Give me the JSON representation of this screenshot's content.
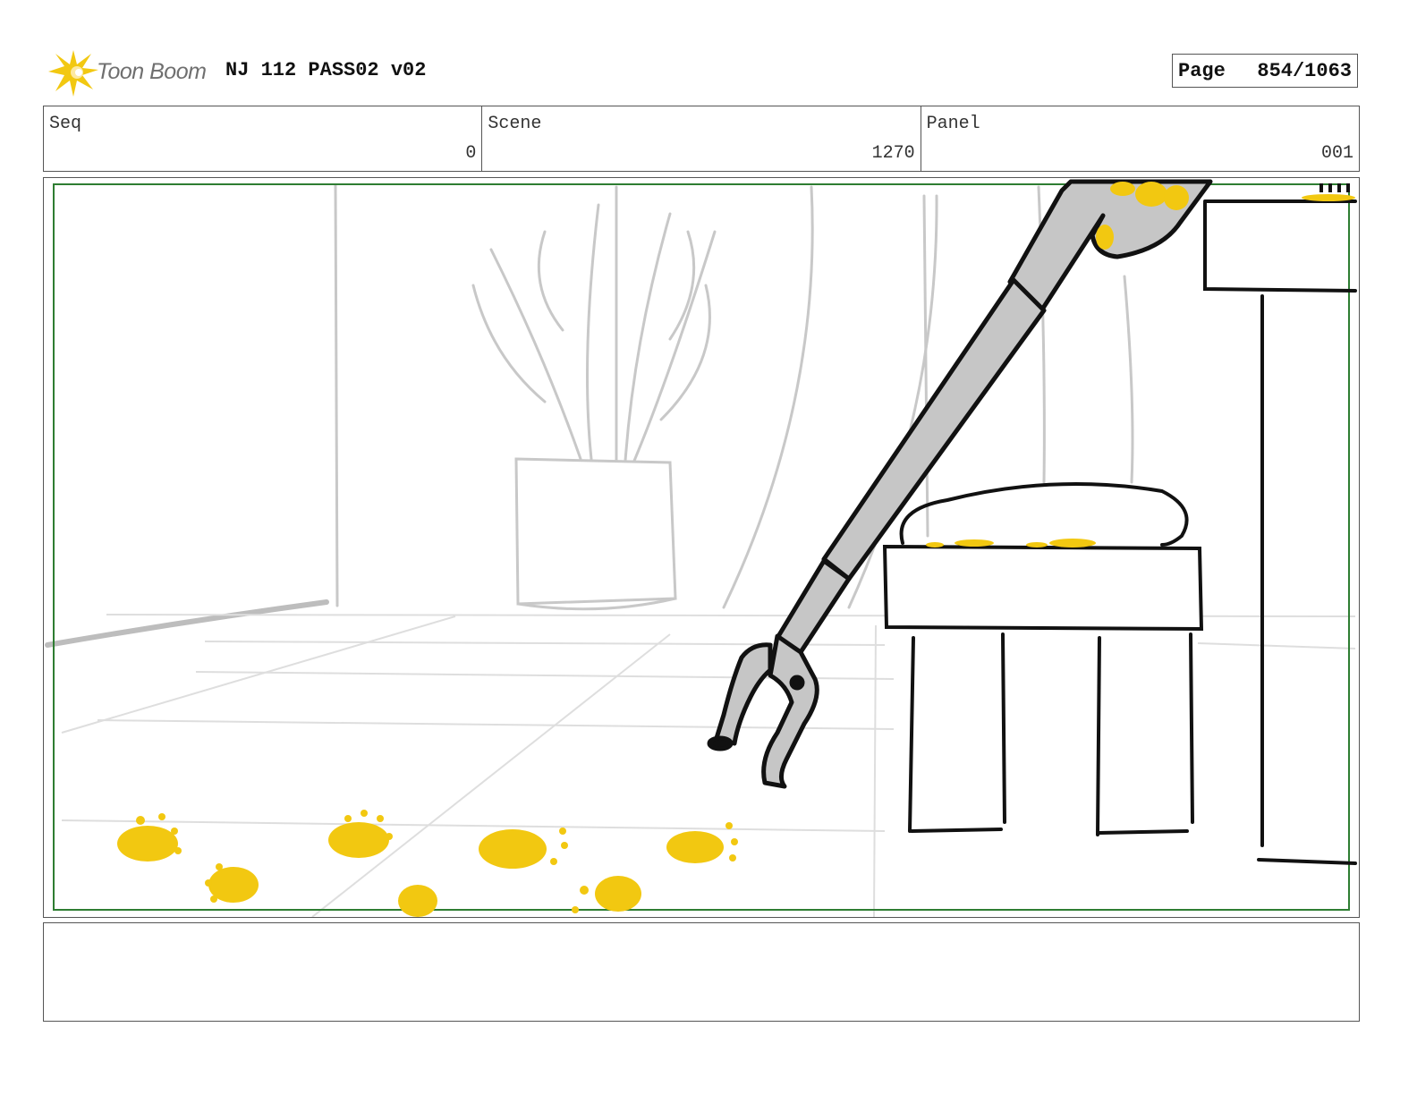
{
  "header": {
    "logo_text": "Toon Boom",
    "project_title": "NJ 112 PASS02 v02",
    "page_label": "Page",
    "page_number": "854/1063"
  },
  "info": {
    "seq_label": "Seq",
    "seq_value": "0",
    "scene_label": "Scene",
    "scene_value": "1270",
    "panel_label": "Panel",
    "panel_value": "001"
  },
  "notes": {
    "text": ""
  },
  "colors": {
    "frame_border": "#555555",
    "safe_area": "#2e7d32",
    "accent_yellow": "#f2c811",
    "sketch_gray": "#bdbdbd",
    "tool_gray": "#c6c6c6"
  }
}
